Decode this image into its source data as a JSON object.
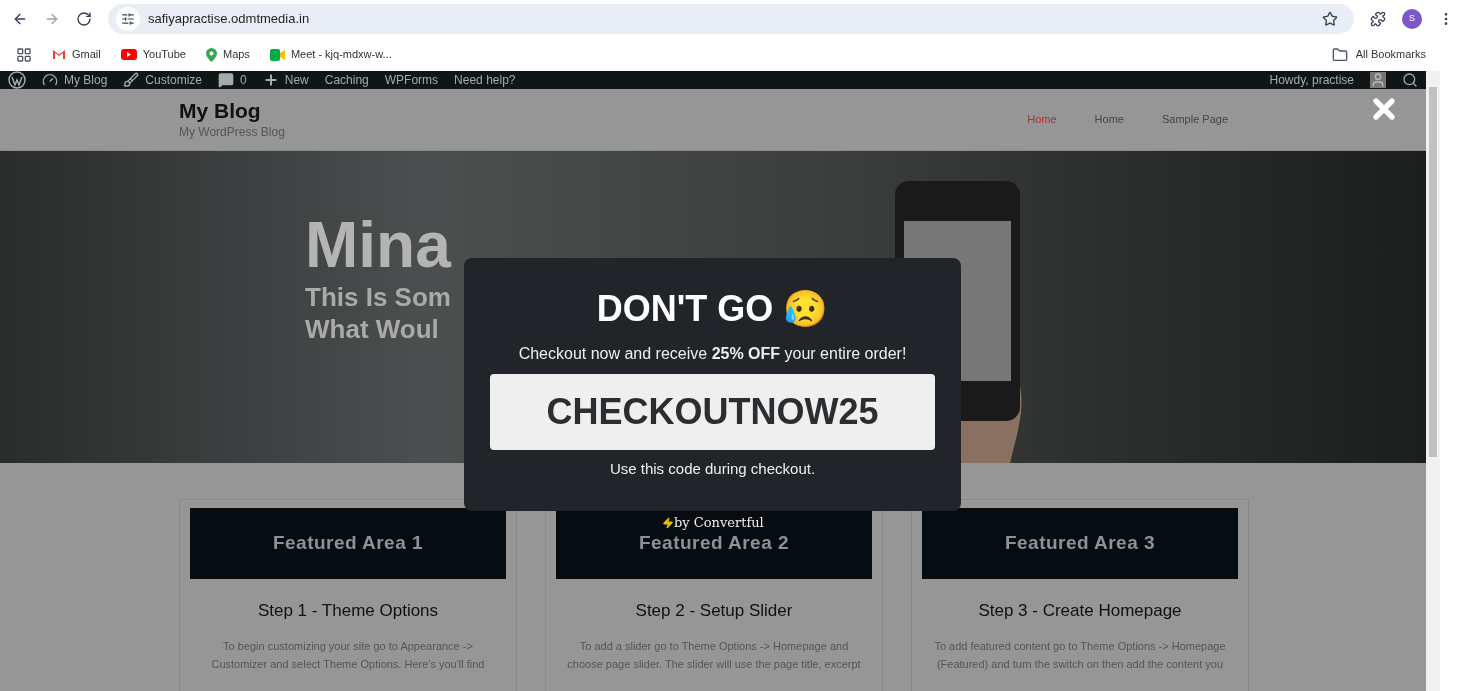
{
  "browser": {
    "url": "safiyapractise.odmtmedia.in",
    "profile_initial": "S",
    "bookmarks": [
      {
        "label": "Gmail",
        "kind": "gmail"
      },
      {
        "label": "YouTube",
        "kind": "youtube"
      },
      {
        "label": "Maps",
        "kind": "maps"
      },
      {
        "label": "Meet - kjq-mdxw-w...",
        "kind": "meet"
      }
    ],
    "all_bookmarks": "All Bookmarks"
  },
  "admin_bar": {
    "items": [
      {
        "label": "My Blog",
        "kind": "dashboard"
      },
      {
        "label": "Customize",
        "kind": "brush"
      },
      {
        "label": "0",
        "kind": "comments"
      },
      {
        "label": "New",
        "kind": "plus"
      },
      {
        "label": "Caching",
        "kind": "text"
      },
      {
        "label": "WPForms",
        "kind": "text"
      },
      {
        "label": "Need help?",
        "kind": "text"
      }
    ],
    "greeting": "Howdy, practise"
  },
  "site": {
    "title": "My Blog",
    "tagline": "My WordPress Blog",
    "nav": [
      {
        "label": "Home",
        "selected": true
      },
      {
        "label": "Home",
        "selected": false
      },
      {
        "label": "Sample Page",
        "selected": false
      }
    ]
  },
  "hero": {
    "title": "Mina",
    "lines": [
      "This Is Som",
      "What Woul"
    ]
  },
  "cards": [
    {
      "banner": "Featured Area 1",
      "heading": "Step 1 - Theme Options",
      "text": "To begin customizing your site go to Appearance -> Customizer and select Theme Options. Here's you'll find"
    },
    {
      "banner": "Featured Area 2",
      "heading": "Step 2 - Setup Slider",
      "text": "To add a slider go to Theme Options -> Homepage and choose page slider. The slider will use the page title, excerpt"
    },
    {
      "banner": "Featured Area 3",
      "heading": "Step 3 - Create Homepage",
      "text": "To add featured content go to Theme Options -> Homepage (Featured) and turn the switch on then add the content you"
    }
  ],
  "popup": {
    "title": "DON'T GO",
    "emoji": "😥",
    "message": "Checkout now and receive **25% OFF** your entire order!",
    "code": "CHECKOUTNOW25",
    "note": "Use this code during checkout.",
    "credit": "by Convertful"
  }
}
